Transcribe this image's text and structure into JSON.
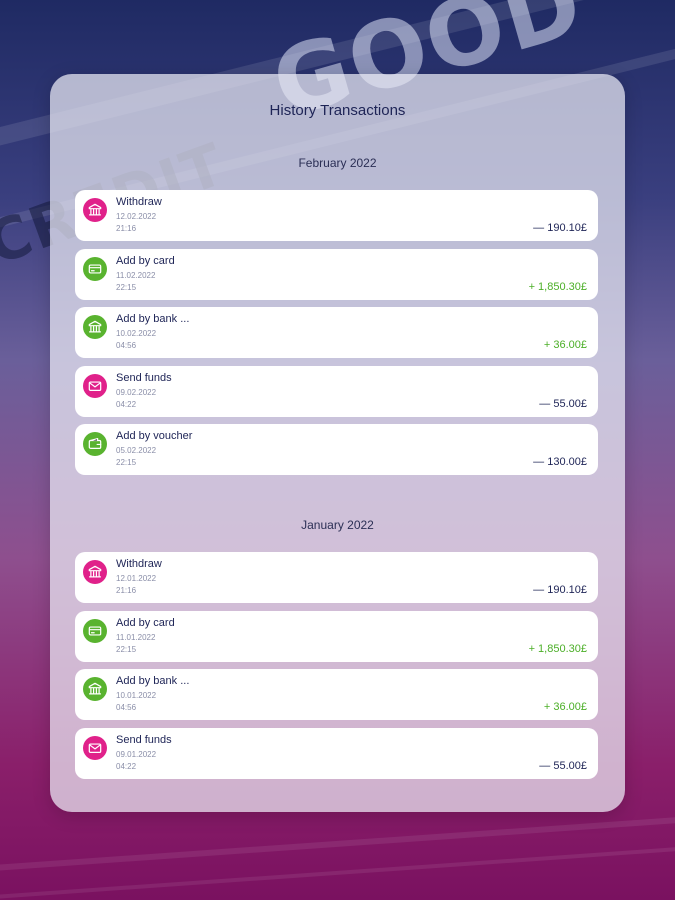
{
  "colors": {
    "withdraw": "#e0218a",
    "deposit": "#59b32f",
    "positive": "#4caf28",
    "text": "#1e2456"
  },
  "background_text": {
    "word1": "GOOD",
    "word2": "CREDIT"
  },
  "title": "History Transactions",
  "months": [
    {
      "label": "February 2022",
      "transactions": [
        {
          "icon": "bank-icon",
          "type": "pink",
          "name": "Withdraw",
          "date": "12.02.2022",
          "time": "21:16",
          "amount": "— 190.10£",
          "positive": false
        },
        {
          "icon": "card-icon",
          "type": "green",
          "name": "Add by card",
          "date": "11.02.2022",
          "time": "22:15",
          "amount": "+ 1,850.30£",
          "positive": true
        },
        {
          "icon": "bank-icon",
          "type": "green",
          "name": "Add by bank ...",
          "date": "10.02.2022",
          "time": "04:56",
          "amount": "+ 36.00£",
          "positive": true
        },
        {
          "icon": "envelope-icon",
          "type": "pink",
          "name": "Send funds",
          "date": "09.02.2022",
          "time": "04:22",
          "amount": "— 55.00£",
          "positive": false
        },
        {
          "icon": "wallet-icon",
          "type": "green",
          "name": "Add by voucher",
          "date": "05.02.2022",
          "time": "22:15",
          "amount": "— 130.00£",
          "positive": false
        }
      ]
    },
    {
      "label": "January 2022",
      "transactions": [
        {
          "icon": "bank-icon",
          "type": "pink",
          "name": "Withdraw",
          "date": "12.01.2022",
          "time": "21:16",
          "amount": "— 190.10£",
          "positive": false
        },
        {
          "icon": "card-icon",
          "type": "green",
          "name": "Add by card",
          "date": "11.01.2022",
          "time": "22:15",
          "amount": "+ 1,850.30£",
          "positive": true
        },
        {
          "icon": "bank-icon",
          "type": "green",
          "name": "Add by bank ...",
          "date": "10.01.2022",
          "time": "04:56",
          "amount": "+ 36.00£",
          "positive": true
        },
        {
          "icon": "envelope-icon",
          "type": "pink",
          "name": "Send funds",
          "date": "09.01.2022",
          "time": "04:22",
          "amount": "— 55.00£",
          "positive": false
        }
      ]
    }
  ]
}
